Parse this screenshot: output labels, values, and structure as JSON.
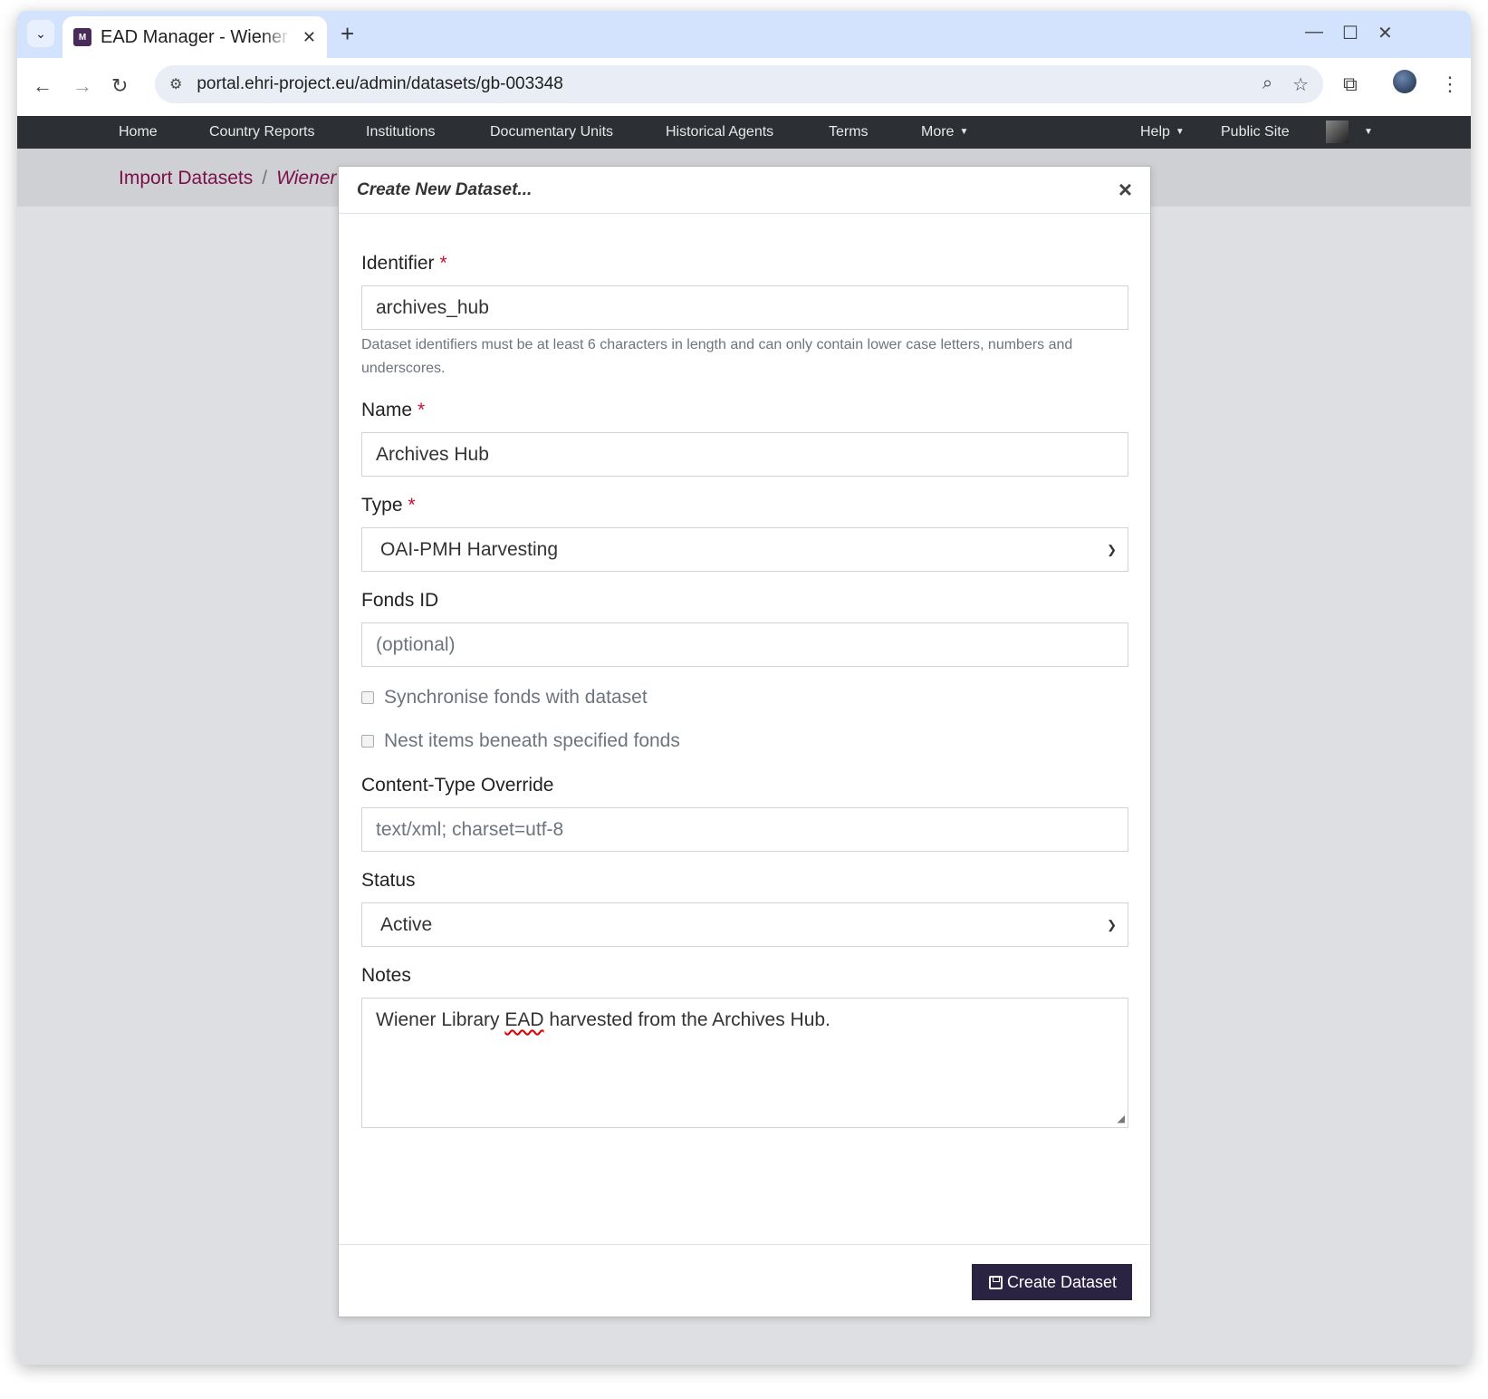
{
  "browser": {
    "tab_title": "EAD Manager - Wiener Holocaust Library",
    "url": "portal.ehri-project.eu/admin/datasets/gb-003348",
    "favicon_text": "M",
    "icons": [
      "chevron-down-icon",
      "close-icon",
      "plus-icon",
      "minimize-icon",
      "maximize-icon",
      "window-close-icon",
      "back-icon",
      "forward-icon",
      "reload-icon",
      "site-settings-icon",
      "zoom-icon",
      "bookmark-star-icon",
      "extensions-icon",
      "profile-avatar",
      "kebab-menu-icon"
    ]
  },
  "site_nav": {
    "items": [
      "Home",
      "Country Reports",
      "Institutions",
      "Documentary Units",
      "Historical Agents",
      "Terms"
    ],
    "more": "More",
    "help": "Help",
    "public_site": "Public Site"
  },
  "breadcrumb": {
    "parent": "Import Datasets",
    "separator": "/",
    "current": "Wiener Holocaust Library"
  },
  "modal": {
    "title": "Create New Dataset...",
    "close_symbol": "×",
    "required_mark": "*",
    "identifier": {
      "label": "Identifier",
      "value": "archives_hub",
      "help": "Dataset identifiers must be at least 6 characters in length and can only contain lower case letters, numbers and underscores."
    },
    "name": {
      "label": "Name",
      "value": "Archives Hub"
    },
    "type": {
      "label": "Type",
      "selected": "OAI-PMH Harvesting"
    },
    "fonds_id": {
      "label": "Fonds ID",
      "placeholder": "(optional)"
    },
    "sync_checkbox": {
      "label": "Synchronise fonds with dataset",
      "checked": false
    },
    "nest_checkbox": {
      "label": "Nest items beneath specified fonds",
      "checked": false
    },
    "content_type": {
      "label": "Content-Type Override",
      "placeholder": "text/xml; charset=utf-8"
    },
    "status": {
      "label": "Status",
      "selected": "Active"
    },
    "notes": {
      "label": "Notes",
      "before": "Wiener Library ",
      "misspelled": "EAD",
      "after": " harvested from the Archives Hub."
    },
    "submit_label": "Create Dataset"
  }
}
